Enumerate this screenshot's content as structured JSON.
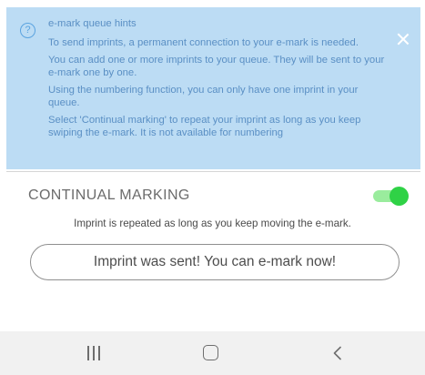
{
  "hints": {
    "title": "e-mark queue hints",
    "paragraphs": [
      "To send imprints, a permanent connection to your e-mark is needed.",
      "You can add one or more imprints to your queue. They will be sent to your e-mark one by one.",
      "Using the numbering function, you can only have one imprint in your queue.",
      "Select 'Continual marking' to repeat your imprint as long as you keep swiping the e-mark. It is not available for numbering"
    ],
    "help_icon": "question-circle-icon",
    "help_glyph": "?",
    "close_icon": "close-icon"
  },
  "continual_marking": {
    "label": "CONTINUAL MARKING",
    "enabled": true,
    "description": "Imprint is repeated as long as you keep moving the e-mark."
  },
  "status": {
    "message": "Imprint was sent! You can e-mark now!"
  },
  "navbar": {
    "recents_icon": "recents-icon",
    "home_icon": "home-icon",
    "back_icon": "back-icon"
  },
  "colors": {
    "hint_background": "#bcdcf4",
    "hint_text": "#5a8fc4",
    "toggle_on": "#2fd246",
    "toggle_track": "#9aec9d",
    "navbar_background": "#f1f1f1"
  }
}
